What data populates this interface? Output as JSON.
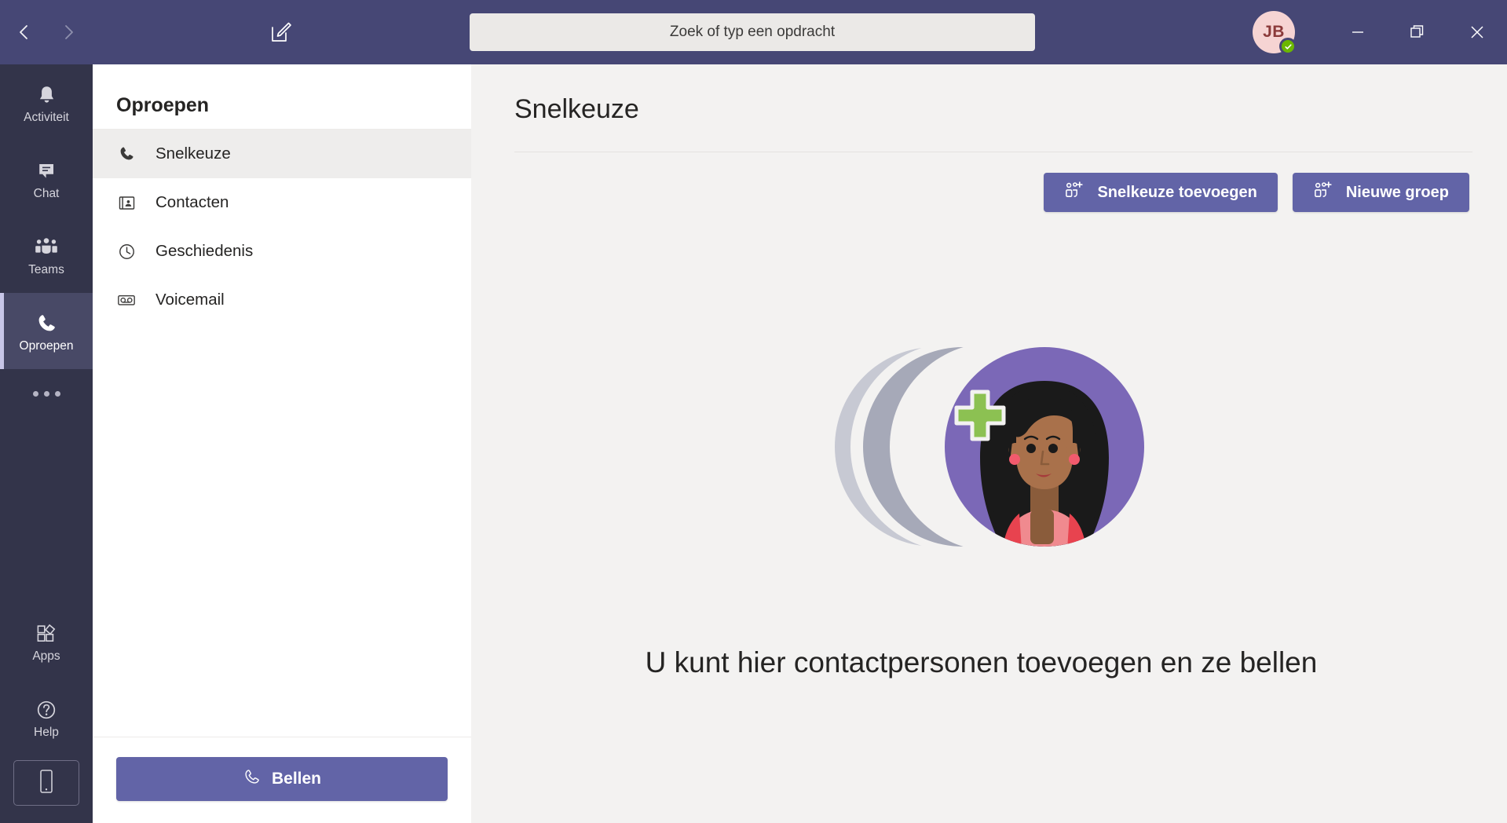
{
  "window": {
    "titlebar": {
      "back_tooltip": "Terug",
      "forward_tooltip": "Vooruit",
      "compose_tooltip": "Nieuw gesprek",
      "minimize_label": "Minimaliseren",
      "restore_label": "Herstellen",
      "close_label": "Sluiten"
    },
    "accent_color": "#464775",
    "rail_color": "#33344a",
    "brand_color": "#6264a7",
    "main_bg_color": "#f3f2f1"
  },
  "search": {
    "placeholder": "Zoek of typ een opdracht",
    "value": ""
  },
  "profile": {
    "initials": "JB",
    "presence": "available",
    "presence_color": "#6bb700",
    "avatar_bg": "#f6d4d3"
  },
  "rail": {
    "items": [
      {
        "id": "activity",
        "label": "Activiteit",
        "icon": "bell-icon",
        "selected": false
      },
      {
        "id": "chat",
        "label": "Chat",
        "icon": "chat-icon",
        "selected": false
      },
      {
        "id": "teams",
        "label": "Teams",
        "icon": "teams-icon",
        "selected": false
      },
      {
        "id": "calls",
        "label": "Oproepen",
        "icon": "phone-icon",
        "selected": true
      }
    ],
    "more_label": "Meer apps",
    "bottom_items": [
      {
        "id": "apps",
        "label": "Apps",
        "icon": "apps-icon"
      },
      {
        "id": "help",
        "label": "Help",
        "icon": "help-icon"
      }
    ],
    "mobile_label": "Mobiele app downloaden"
  },
  "panel": {
    "title": "Oproepen",
    "items": [
      {
        "id": "speed-dial",
        "label": "Snelkeuze",
        "icon": "phone-icon",
        "selected": true
      },
      {
        "id": "contacts",
        "label": "Contacten",
        "icon": "contact-card-icon",
        "selected": false
      },
      {
        "id": "history",
        "label": "Geschiedenis",
        "icon": "clock-icon",
        "selected": false
      },
      {
        "id": "voicemail",
        "label": "Voicemail",
        "icon": "voicemail-icon",
        "selected": false
      }
    ],
    "call_button_label": "Bellen"
  },
  "main": {
    "title": "Snelkeuze",
    "actions": [
      {
        "id": "add-speed-dial",
        "label": "Snelkeuze toevoegen",
        "icon": "add-person-icon"
      },
      {
        "id": "new-group",
        "label": "Nieuwe groep",
        "icon": "add-person-icon"
      }
    ],
    "empty_state": {
      "message": "U kunt hier contactpersonen toevoegen en ze bellen",
      "illustration": "add-contact-illustration",
      "colors": {
        "circle_back": "#c7c9d3",
        "circle_mid": "#a6a9b8",
        "circle_front": "#7b68b7",
        "plus": "#8cc152",
        "skin": "#a9714b",
        "hair": "#1a1a1a",
        "shirt": "#f08a8f",
        "shirt_dark": "#e8434f"
      }
    }
  }
}
